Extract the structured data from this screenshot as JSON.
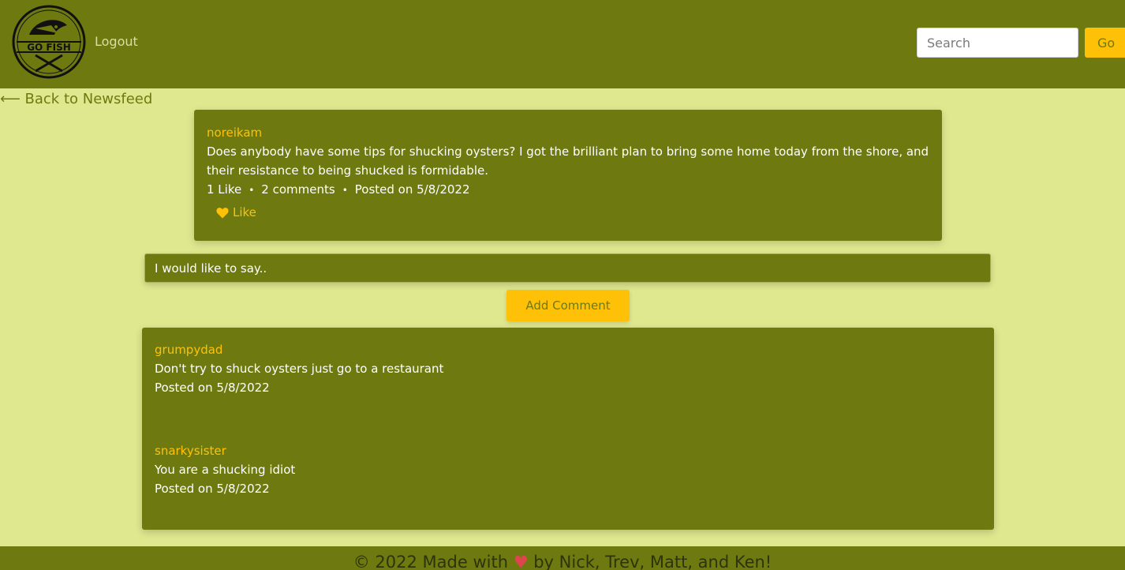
{
  "navbar": {
    "logo_text": "GO FISH",
    "logout_label": "Logout",
    "search_placeholder": "Search",
    "go_label": "Go"
  },
  "back_link": "⟵ Back to Newsfeed",
  "post": {
    "username": "noreikam",
    "body": "Does anybody have some tips for shucking oysters? I got the brilliant plan to bring some home today from the shore, and their resistance to being shucked is formidable.",
    "likes": "1 Like",
    "comments": "2 comments",
    "posted": "Posted on 5/8/2022",
    "like_label": "Like"
  },
  "comment_form": {
    "placeholder": "I would like to say..",
    "submit_label": "Add Comment"
  },
  "comments": [
    {
      "username": "grumpydad",
      "body": "Don't try to shuck oysters just go to a restaurant",
      "posted": "Posted on 5/8/2022"
    },
    {
      "username": "snarkysister",
      "body": "You are a shucking idiot",
      "posted": "Posted on 5/8/2022"
    }
  ],
  "footer": {
    "prefix": "© 2022 Made with",
    "heart": "♥",
    "suffix": "by Nick, Trev, Matt, and Ken!"
  },
  "colors": {
    "brand_dark": "#6e7a10",
    "background": "#e0e88f",
    "accent": "#ffc107"
  }
}
